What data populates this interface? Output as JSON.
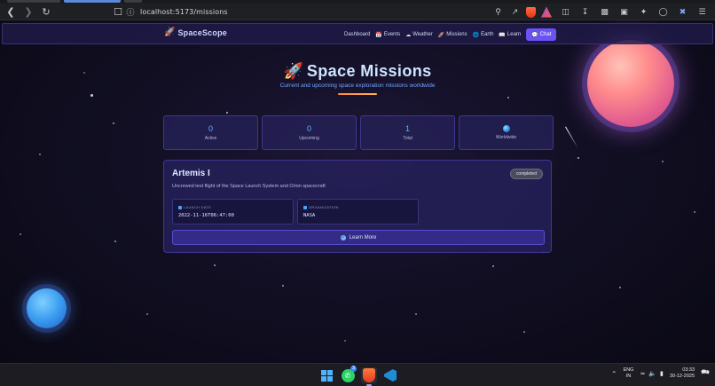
{
  "browser": {
    "url": "localhost:5173/missions",
    "icons": [
      "back-icon",
      "forward-icon",
      "reload-icon",
      "bookmark-icon",
      "site-info-icon",
      "zoom-icon",
      "share-icon",
      "brave-shield-icon",
      "brave-rewards-icon",
      "sidebar-icon",
      "downloads-icon",
      "split-view-icon",
      "wallet-icon",
      "leo-icon",
      "vpn-icon",
      "extension-icon",
      "menu-icon"
    ],
    "colors": {
      "toolbar": "#1f2023",
      "active_tab": "#5b8bd8"
    }
  },
  "nav": {
    "brand": "SpaceScope",
    "links": [
      {
        "label": "Dashboard",
        "icon": ""
      },
      {
        "label": "Events",
        "icon": "calendar-icon"
      },
      {
        "label": "Weather",
        "icon": "cloud-icon"
      },
      {
        "label": "Missions",
        "icon": "rocket-icon"
      },
      {
        "label": "Earth",
        "icon": "globe-icon"
      },
      {
        "label": "Learn",
        "icon": "book-icon"
      }
    ],
    "chat_label": "Chat"
  },
  "hero": {
    "title": "Space Missions",
    "subtitle": "Current and upcoming space exploration missions worldwide"
  },
  "stats": [
    {
      "value": "0",
      "label": "Active"
    },
    {
      "value": "0",
      "label": "Upcoming"
    },
    {
      "value": "1",
      "label": "Total"
    },
    {
      "value": "",
      "label": "Worldwide"
    }
  ],
  "mission": {
    "name": "Artemis I",
    "status": "completed",
    "description": "Uncrewed test flight of the Space Launch System and Orion spacecraft",
    "launch_label": "LAUNCH DATE",
    "launch_value": "2022-11-16T06:47:00",
    "org_label": "ORGANIZATION",
    "org_value": "NASA",
    "learn_more": "Learn More"
  },
  "taskbar": {
    "lang_top": "ENG",
    "lang_bottom": "IN",
    "time": "03:33",
    "date": "30-12-2025",
    "whatsapp_badge": "3"
  },
  "colors": {
    "accent": "#6b52f5",
    "stat_value": "#57b8ff",
    "subtitle": "#6ea6ff",
    "rule": "#ff8a3d"
  }
}
